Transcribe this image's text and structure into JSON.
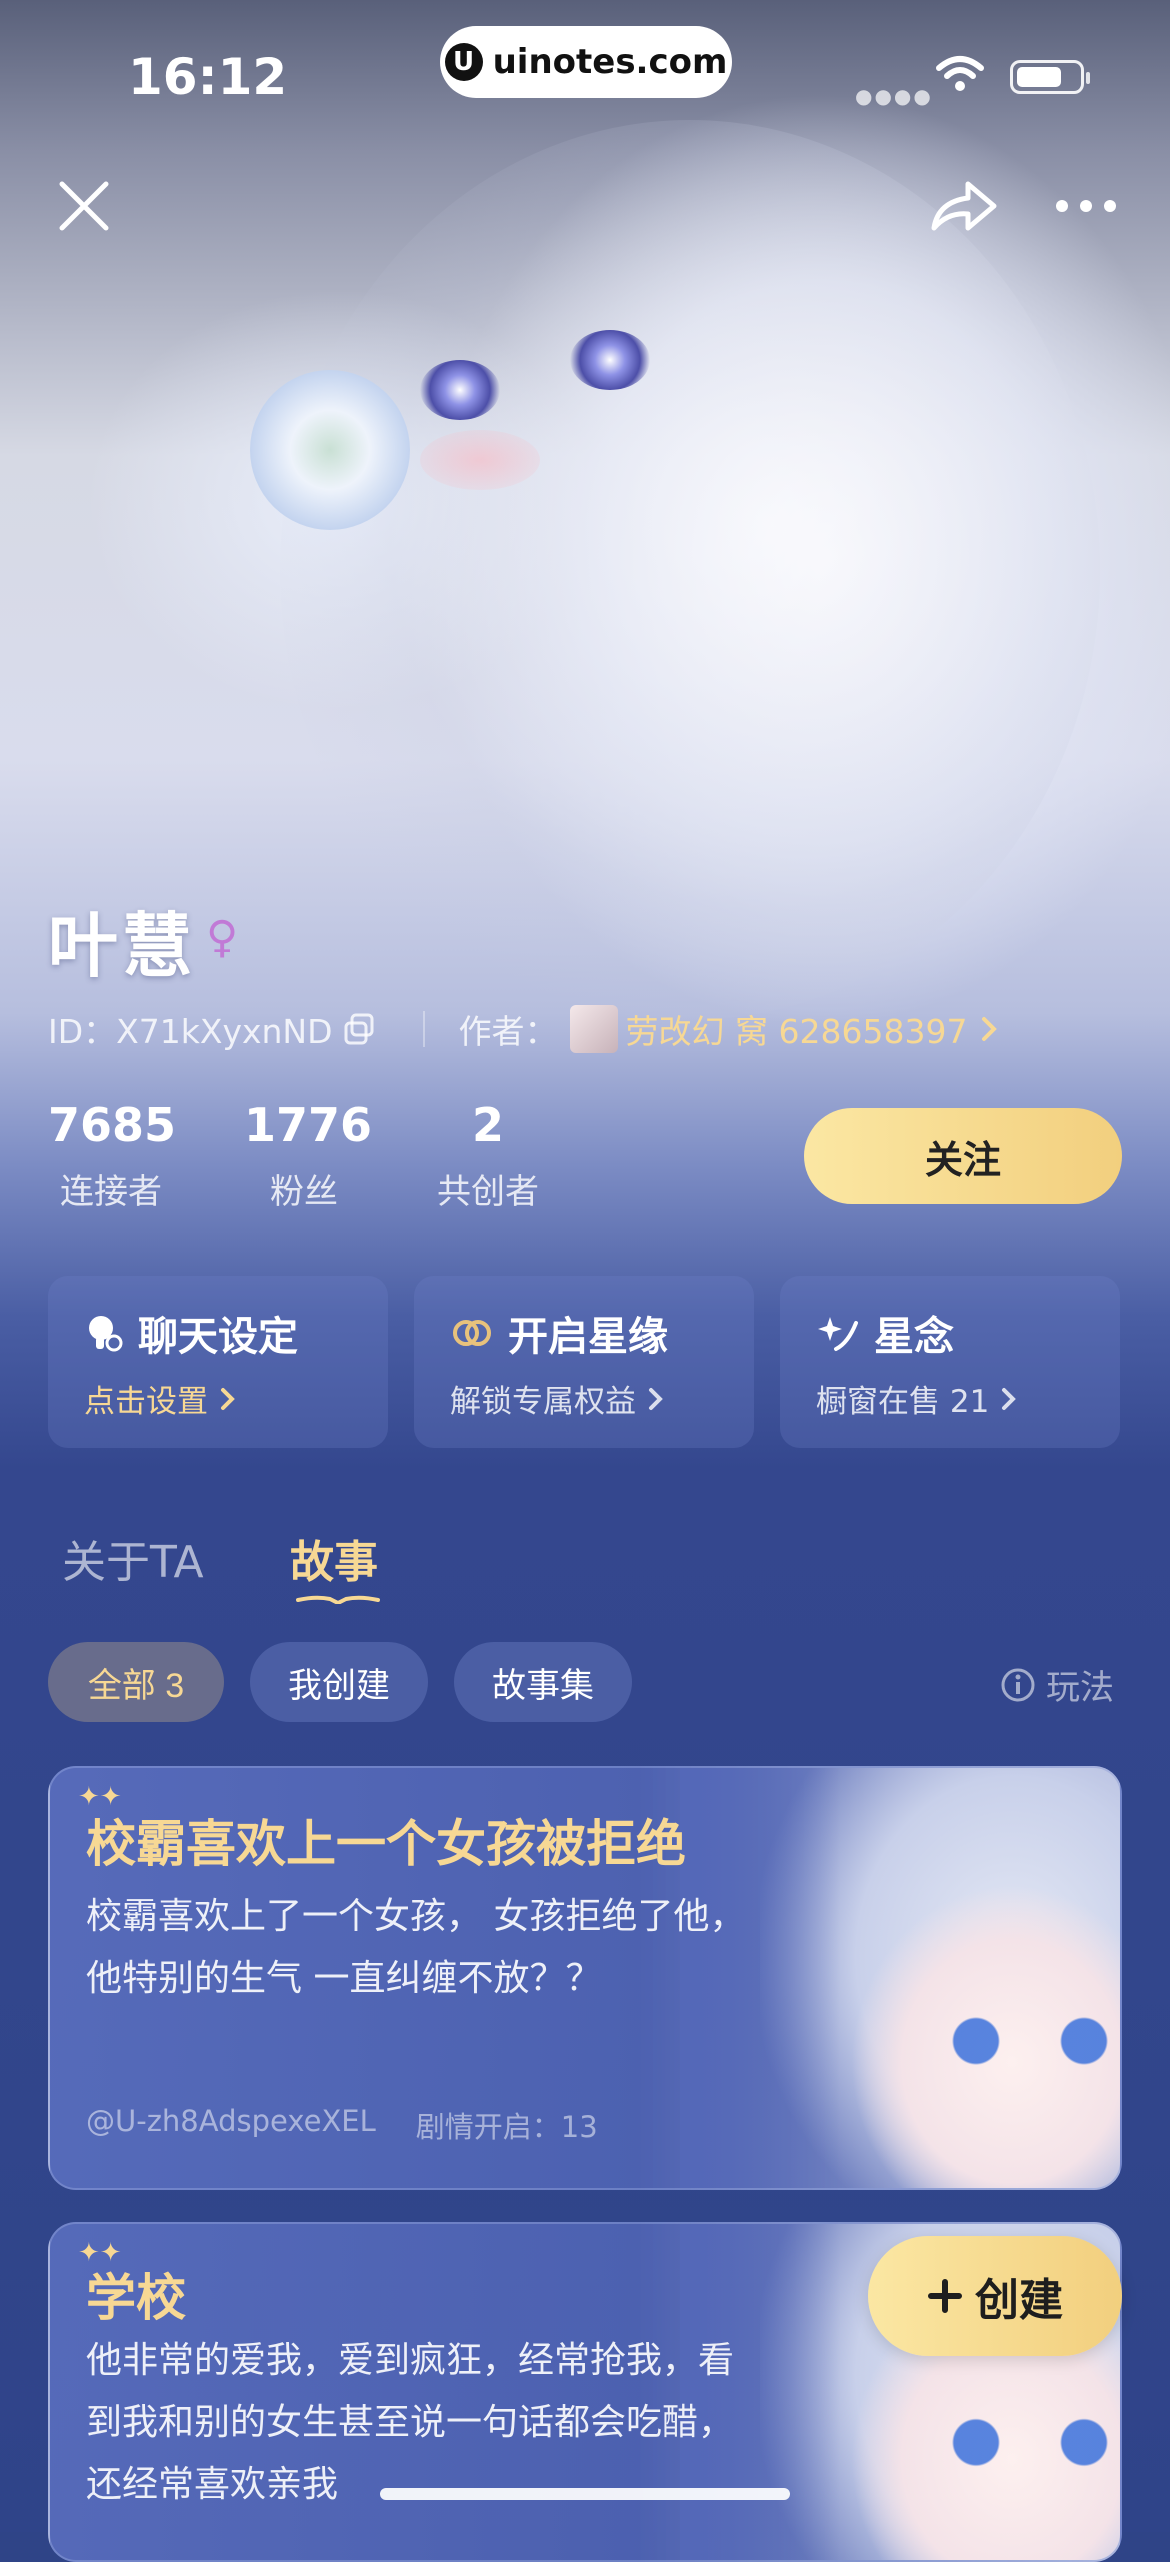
{
  "status_bar": {
    "time": "16:12",
    "url": "uinotes.com",
    "url_logo": "U"
  },
  "profile": {
    "name": "叶慧",
    "gender_symbol": "♀",
    "id_label": "ID：X71kXyxnND",
    "author_label": "作者：",
    "author_name": "劳改幻 窝 628658397"
  },
  "stats": [
    {
      "value": "7685",
      "label": "连接者"
    },
    {
      "value": "1776",
      "label": "粉丝"
    },
    {
      "value": "2",
      "label": "共创者"
    }
  ],
  "follow_label": "关注",
  "cards": [
    {
      "title": "聊天设定",
      "subtitle": "点击设置",
      "icon": "chat-settings-icon"
    },
    {
      "title": "开启星缘",
      "subtitle": "解锁专属权益",
      "icon": "rings-icon"
    },
    {
      "title": "星念",
      "subtitle": "橱窗在售 21",
      "icon": "star-wish-icon"
    }
  ],
  "tabs": [
    {
      "label": "关于TA",
      "active": false
    },
    {
      "label": "故事",
      "active": true
    }
  ],
  "filters": [
    {
      "label": "全部 3",
      "active": true
    },
    {
      "label": "我创建",
      "active": false
    },
    {
      "label": "故事集",
      "active": false
    }
  ],
  "rules_label": "玩法",
  "stories": [
    {
      "title": "校霸喜欢上一个女孩被拒绝",
      "description": "校霸喜欢上了一个女孩， 女孩拒绝了他， 他特别的生气 一直纠缠不放？？",
      "author": "@U-zh8AdspexeXEL",
      "plot_count": "剧情开启：13"
    },
    {
      "title": "学校",
      "description": "他非常的爱我，爱到疯狂，经常抢我，看到我和别的女生甚至说一句话都会吃醋，还经常喜欢亲我"
    }
  ],
  "create_label": "创建",
  "colors": {
    "accent_gold": "#f7d894",
    "background": "#2f4487",
    "follow_button": "#f5d888"
  }
}
